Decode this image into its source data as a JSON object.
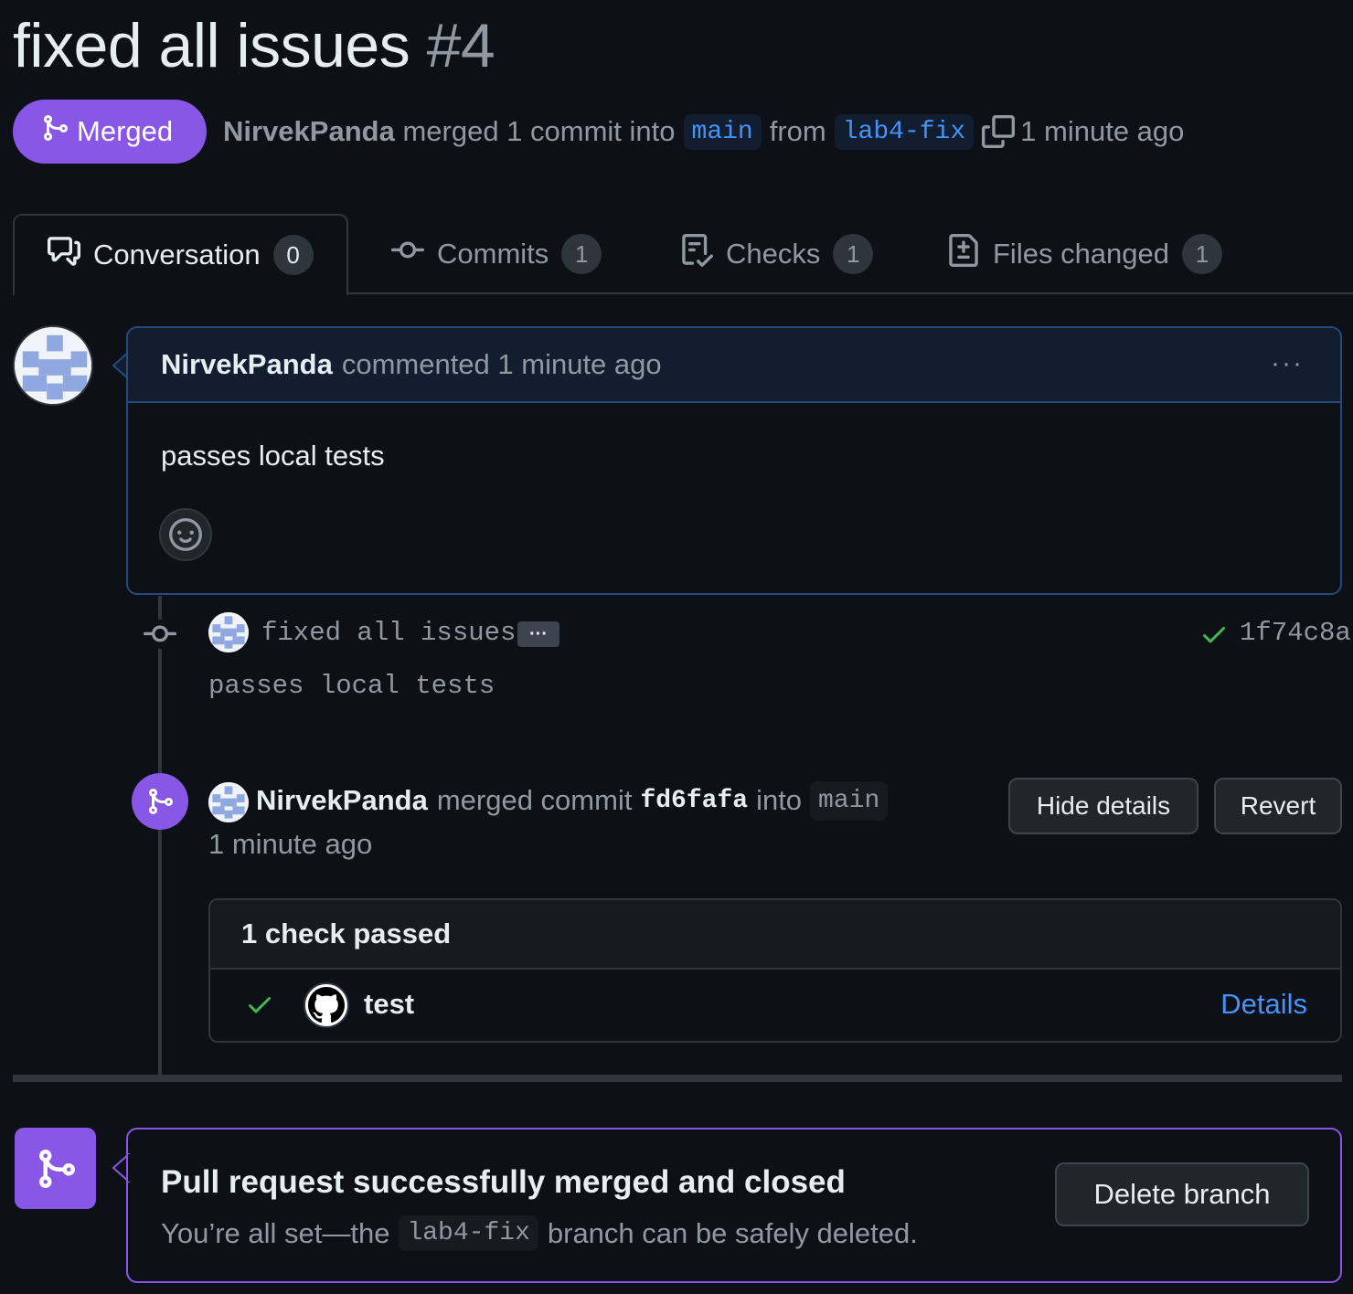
{
  "pr": {
    "title": "fixed all issues",
    "number": "#4",
    "state_label": "Merged",
    "author": "NirvekPanda",
    "merge_text": "merged 1 commit into",
    "base_branch": "main",
    "from_text": "from",
    "head_branch": "lab4-fix",
    "time": "1 minute ago"
  },
  "tabs": [
    {
      "label": "Conversation",
      "count": "0",
      "icon": "comment-discussion-icon"
    },
    {
      "label": "Commits",
      "count": "1",
      "icon": "commit-icon"
    },
    {
      "label": "Checks",
      "count": "1",
      "icon": "checklist-icon"
    },
    {
      "label": "Files changed",
      "count": "1",
      "icon": "file-diff-icon"
    }
  ],
  "comment": {
    "author": "NirvekPanda",
    "action": "commented 1 minute ago",
    "menu_label": "···",
    "body": "passes local tests"
  },
  "commit": {
    "title": "fixed all issues",
    "ellipsis": "···",
    "sha": "1f74c8a",
    "description": "passes local tests"
  },
  "merge_event": {
    "author": "NirvekPanda",
    "text1": "merged commit",
    "sha": "fd6fafa",
    "text2": "into",
    "branch": "main",
    "time": "1 minute ago",
    "hide_details_label": "Hide details",
    "revert_label": "Revert"
  },
  "checks": {
    "summary": "1 check passed",
    "items": [
      {
        "name": "test",
        "status": "success",
        "details_label": "Details"
      }
    ]
  },
  "merged_box": {
    "title": "Pull request successfully merged and closed",
    "sub_before": "You’re all set—the",
    "branch": "lab4-fix",
    "sub_after": "branch can be safely deleted.",
    "delete_label": "Delete branch"
  },
  "colors": {
    "merged": "#8957e5",
    "link": "#4493f8",
    "success": "#3fb950",
    "background": "#0d1117"
  }
}
